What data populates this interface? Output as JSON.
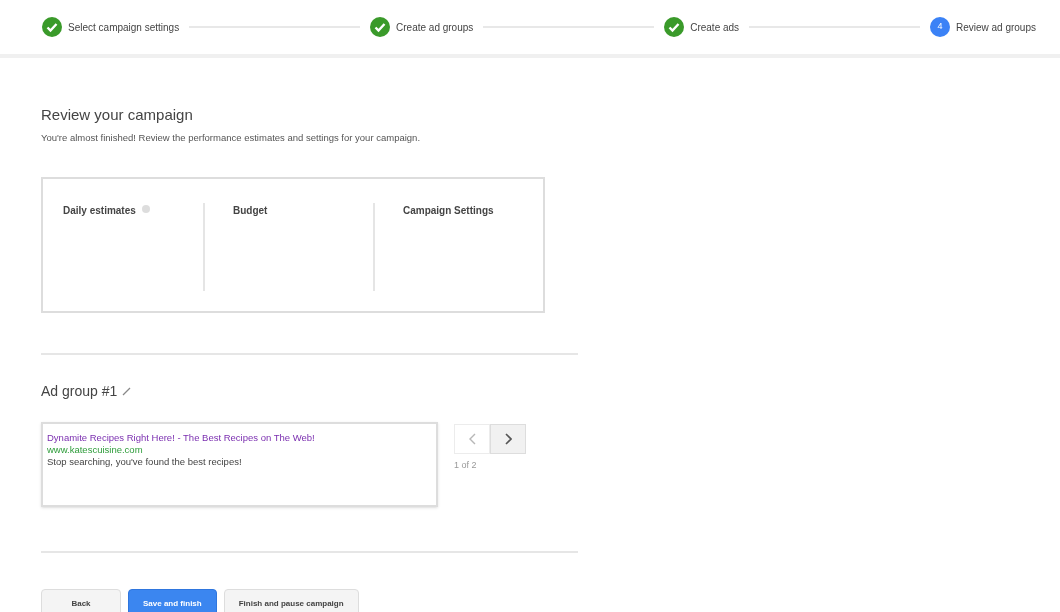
{
  "steps": [
    {
      "label": "Select campaign settings",
      "completed": true
    },
    {
      "label": "Create ad groups",
      "completed": true
    },
    {
      "label": "Create ads",
      "completed": true
    },
    {
      "label": "Review ad groups",
      "completed": false,
      "number": "4"
    }
  ],
  "heading": "Review your campaign",
  "subheading": "You're almost finished! Review the performance estimates and settings for your campaign.",
  "summary_columns": [
    {
      "title": "Daily estimates",
      "has_help": true
    },
    {
      "title": "Budget",
      "has_help": false
    },
    {
      "title": "Campaign Settings",
      "has_help": false
    }
  ],
  "ad_group": {
    "title": "Ad group #1",
    "ad": {
      "headline": "Dynamite Recipes Right Here! - The Best Recipes on The Web!",
      "url": "www.katescuisine.com",
      "description": "Stop searching, you've found the best recipes!"
    },
    "pager": "1 of 2",
    "prev_disabled": true
  },
  "buttons": [
    {
      "label": "Back",
      "kind": "secondary"
    },
    {
      "label": "Save and finish",
      "kind": "primary"
    },
    {
      "label": "Finish and pause campaign",
      "kind": "secondary"
    }
  ]
}
